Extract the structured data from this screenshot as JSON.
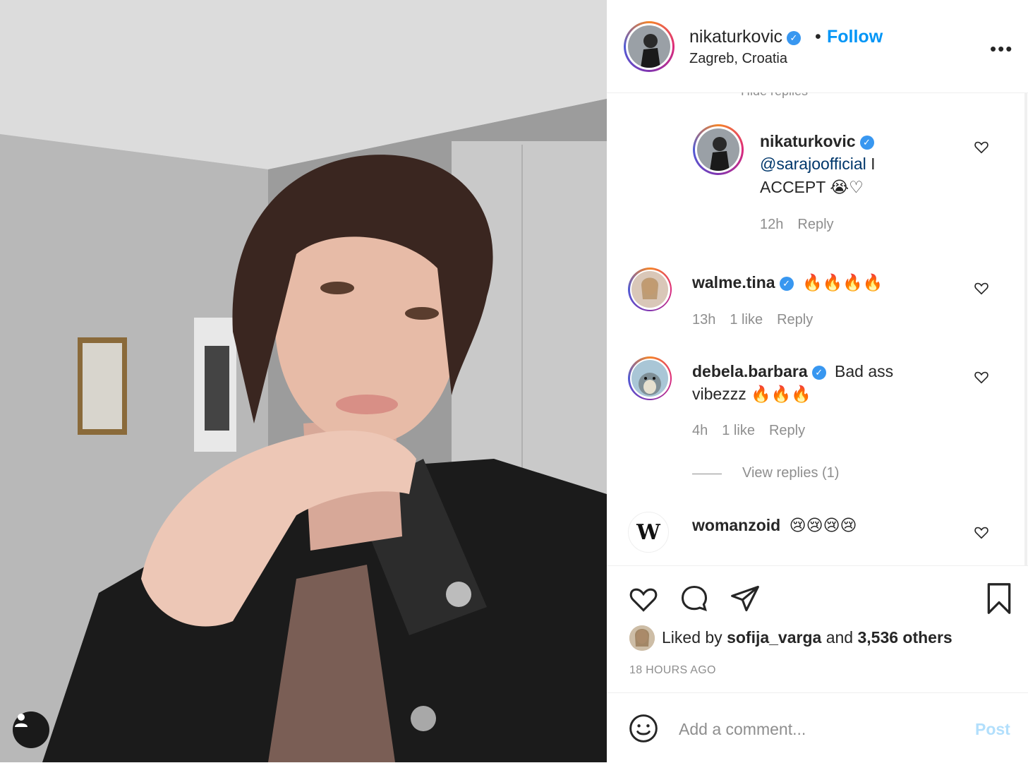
{
  "post": {
    "username": "nikaturkovic",
    "location": "Zagreb, Croatia",
    "follow_label": "Follow",
    "separator": "•",
    "more_label": "•••"
  },
  "comments": {
    "hidden_replies_partial": "Hide replies",
    "items": [
      {
        "username": "nikaturkovic",
        "verified": true,
        "mention": "@sarajoofficial",
        "text_after_mention": " I",
        "text_line2": "ACCEPT 😭♡",
        "time": "12h",
        "likes": "",
        "reply_label": "Reply"
      },
      {
        "username": "walme.tina",
        "verified": true,
        "text": "🔥🔥🔥🔥",
        "time": "13h",
        "likes": "1 like",
        "reply_label": "Reply"
      },
      {
        "username": "debela.barbara",
        "verified": true,
        "text": "Bad ass",
        "text_line2": "vibezzz 🔥🔥🔥",
        "time": "4h",
        "likes": "1 like",
        "reply_label": "Reply",
        "view_replies": "View replies (1)"
      },
      {
        "username": "womanzoid",
        "verified": false,
        "text": "😢😢😢😢",
        "avatar_letter": "W"
      }
    ]
  },
  "engagement": {
    "liked_prefix": "Liked by ",
    "liked_user": "sofija_varga",
    "liked_mid": " and ",
    "liked_count": "3,536 others",
    "timestamp": "18 HOURS AGO"
  },
  "composer": {
    "placeholder": "Add a comment...",
    "post_label": "Post"
  },
  "colors": {
    "accent": "#0095f6",
    "verified": "#3897f0",
    "muted": "#8e8e8e",
    "post_disabled": "#b2dffc"
  }
}
